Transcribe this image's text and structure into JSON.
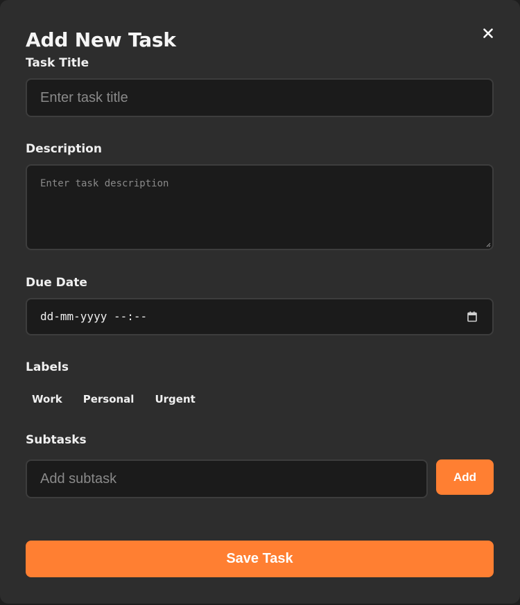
{
  "modal": {
    "title": "Add New Task",
    "close_icon": "close-icon"
  },
  "task_title": {
    "label": "Task Title",
    "value": "",
    "placeholder": "Enter task title"
  },
  "description": {
    "label": "Description",
    "value": "",
    "placeholder": "Enter task description"
  },
  "due_date": {
    "label": "Due Date",
    "value": "dd-mm-yyyy --:--",
    "icon": "calendar-icon"
  },
  "labels": {
    "heading": "Labels",
    "items": [
      "Work",
      "Personal",
      "Urgent"
    ]
  },
  "subtasks": {
    "heading": "Subtasks",
    "placeholder": "Add subtask",
    "value": "",
    "add_label": "Add"
  },
  "actions": {
    "save_label": "Save Task"
  },
  "colors": {
    "background": "#2d2d2d",
    "input_bg": "#1b1b1b",
    "accent": "#ff7f32",
    "text": "#f0f0f0",
    "placeholder": "#8a8a8a"
  }
}
